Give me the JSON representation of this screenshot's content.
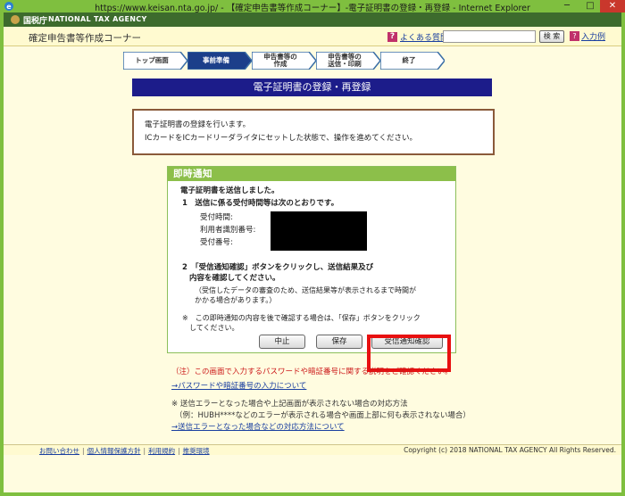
{
  "window": {
    "title": "https://www.keisan.nta.go.jp/ - 【確定申告書等作成コーナー】-電子証明書の登録・再登録 - Internet Explorer",
    "minimize": "─",
    "maximize": "□",
    "close": "✕"
  },
  "agency": {
    "name_jp": "国税庁",
    "name_en": "NATIONAL TAX AGENCY"
  },
  "header": {
    "site_title": "確定申告書等作成コーナー",
    "faq_icon": "?",
    "faq_label": "よくある質問",
    "search_placeholder": "",
    "search_button": "検 索",
    "help_icon": "?",
    "help_label": "入力例"
  },
  "steps": [
    {
      "label": "トップ画面"
    },
    {
      "label": "事前準備"
    },
    {
      "label_l1": "申告書等の",
      "label_l2": "作成"
    },
    {
      "label_l1": "申告書等の",
      "label_l2": "送信・印刷"
    },
    {
      "label": "終了"
    }
  ],
  "page_title": "電子証明書の登録・再登録",
  "intro": {
    "line1": "電子証明書の登録を行います。",
    "line2": "ICカードをICカードリーダライタにセットした状態で、操作を進めてください。"
  },
  "notification": {
    "heading": "即時通知",
    "sent": "電子証明書を送信しました。",
    "item1": "1　送信に係る受付時間等は次のとおりです。",
    "reception_time_label": "受付時間:",
    "user_id_label": "利用者識別番号:",
    "reception_no_label": "受付番号:",
    "item2_l1": "2　「受信通知確認」ボタンをクリックし、送信結果及び",
    "item2_l2": "内容を確認してください。",
    "item2_note_l1": "（受信したデータの審査のため、送信結果等が表示されるまで時間が",
    "item2_note_l2": "かかる場合があります。）",
    "note_l1": "※　この即時通知の内容を後で確認する場合は、「保存」ボタンをクリック",
    "note_l2": "してください。",
    "btn_stop": "中止",
    "btn_save": "保存",
    "btn_confirm": "受信通知確認"
  },
  "caution": "（注）この画面で入力するパスワードや暗証番号に関する説明をご確認ください。",
  "link_password": "→パスワードや暗証番号の入力について",
  "error_note_l1": "※ 送信エラーとなった場合や上記画面が表示されない場合の対応方法",
  "error_note_l2": "（例：HUBH****などのエラーが表示される場合や画面上部に何も表示されない場合）",
  "link_error": "→送信エラーとなった場合などの対応方法について",
  "footer": {
    "links": [
      "お問い合わせ",
      "個人情報保護方針",
      "利用規約",
      "推奨環境"
    ],
    "separator": "|",
    "copyright": "Copyright (c) 2018 NATIONAL TAX AGENCY All Rights Reserved."
  },
  "colors": {
    "window_frame": "#7fbf3f",
    "agency_bar": "#3d6b2d",
    "title_bar": "#1c1c8a",
    "panel_header": "#8cbf4a",
    "highlight": "#e81010"
  }
}
